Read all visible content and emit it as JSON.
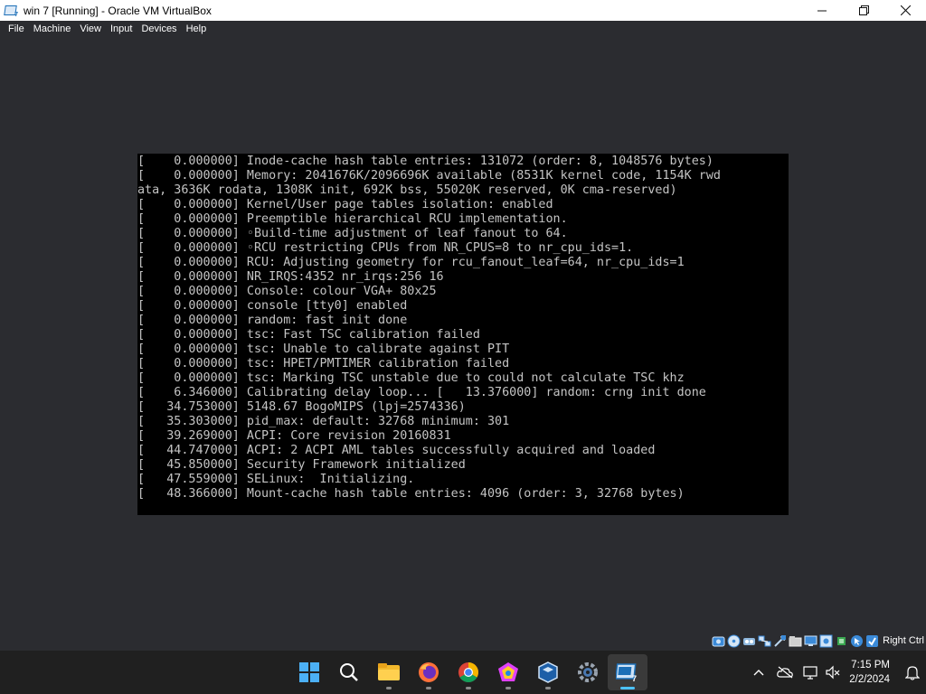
{
  "window": {
    "title": "win 7 [Running] - Oracle VM VirtualBox",
    "app_icon_badge": "7"
  },
  "menu": [
    "File",
    "Machine",
    "View",
    "Input",
    "Devices",
    "Help"
  ],
  "console_lines": [
    "[    0.000000] Inode-cache hash table entries: 131072 (order: 8, 1048576 bytes)",
    "[    0.000000] Memory: 2041676K/2096696K available (8531K kernel code, 1154K rwd",
    "ata, 3636K rodata, 1308K init, 692K bss, 55020K reserved, 0K cma-reserved)",
    "[    0.000000] Kernel/User page tables isolation: enabled",
    "[    0.000000] Preemptible hierarchical RCU implementation.",
    "[    0.000000] ◦Build-time adjustment of leaf fanout to 64.",
    "[    0.000000] ◦RCU restricting CPUs from NR_CPUS=8 to nr_cpu_ids=1.",
    "[    0.000000] RCU: Adjusting geometry for rcu_fanout_leaf=64, nr_cpu_ids=1",
    "[    0.000000] NR_IRQS:4352 nr_irqs:256 16",
    "[    0.000000] Console: colour VGA+ 80x25",
    "[    0.000000] console [tty0] enabled",
    "[    0.000000] random: fast init done",
    "[    0.000000] tsc: Fast TSC calibration failed",
    "[    0.000000] tsc: Unable to calibrate against PIT",
    "[    0.000000] tsc: HPET/PMTIMER calibration failed",
    "[    0.000000] tsc: Marking TSC unstable due to could not calculate TSC khz",
    "[    6.346000] Calibrating delay loop... [   13.376000] random: crng init done",
    "[   34.753000] 5148.67 BogoMIPS (lpj=2574336)",
    "[   35.303000] pid_max: default: 32768 minimum: 301",
    "[   39.269000] ACPI: Core revision 20160831",
    "[   44.747000] ACPI: 2 ACPI AML tables successfully acquired and loaded",
    "[   45.850000] Security Framework initialized",
    "[   47.559000] SELinux:  Initializing.",
    "[   48.366000] Mount-cache hash table entries: 4096 (order: 3, 32768 bytes)"
  ],
  "statusbar": {
    "host_key": "Right Ctrl",
    "icons": [
      "hard-disk-icon",
      "optical-drive-icon",
      "audio-icon",
      "network-icon",
      "usb-icon",
      "shared-folders-icon",
      "display-icon",
      "recording-icon",
      "cpu-icon",
      "mouse-integration-icon",
      "keyboard-icon"
    ]
  },
  "taskbar": {
    "apps": [
      "start-icon",
      "search-icon",
      "file-explorer-icon",
      "firefox-icon",
      "chrome-icon",
      "tailscale-icon",
      "virtualbox-icon",
      "settings-icon",
      "vm-window-icon"
    ],
    "active_app": "vm-window-icon",
    "clock_time": "7:15 PM",
    "clock_date": "2/2/2024"
  },
  "colors": {
    "window_bg": "#2b2c30",
    "console_bg": "#000000",
    "console_fg": "#c4c4c4",
    "taskbar_bg": "#202020",
    "accent": "#4cc2ff"
  }
}
